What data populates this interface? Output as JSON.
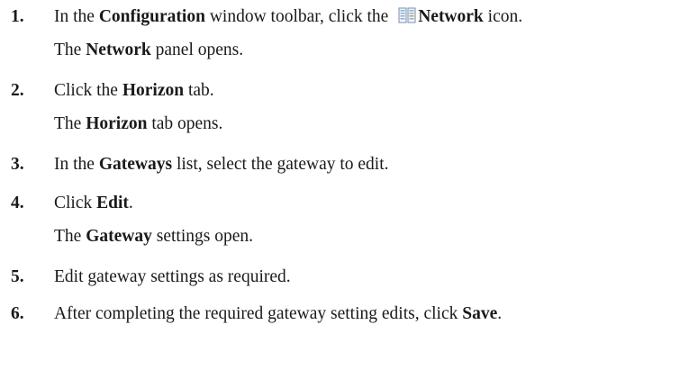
{
  "steps": [
    {
      "number": "1.",
      "parts": [
        "In the ",
        "Configuration",
        " window toolbar, click the ",
        "Network",
        " icon."
      ],
      "icon": "network-icon",
      "result": [
        "The ",
        "Network",
        " panel opens."
      ]
    },
    {
      "number": "2.",
      "parts": [
        "Click the ",
        "Horizon",
        " tab."
      ],
      "result": [
        "The ",
        "Horizon",
        " tab opens."
      ]
    },
    {
      "number": "3.",
      "parts": [
        "In the ",
        "Gateways",
        " list, select the gateway to edit."
      ]
    },
    {
      "number": "4.",
      "parts": [
        "Click ",
        "Edit",
        "."
      ],
      "result": [
        "The ",
        "Gateway",
        " settings open."
      ]
    },
    {
      "number": "5.",
      "parts": [
        "Edit gateway settings as required."
      ]
    },
    {
      "number": "6.",
      "parts": [
        "After completing the required gateway setting edits, click ",
        "Save",
        "."
      ]
    }
  ]
}
